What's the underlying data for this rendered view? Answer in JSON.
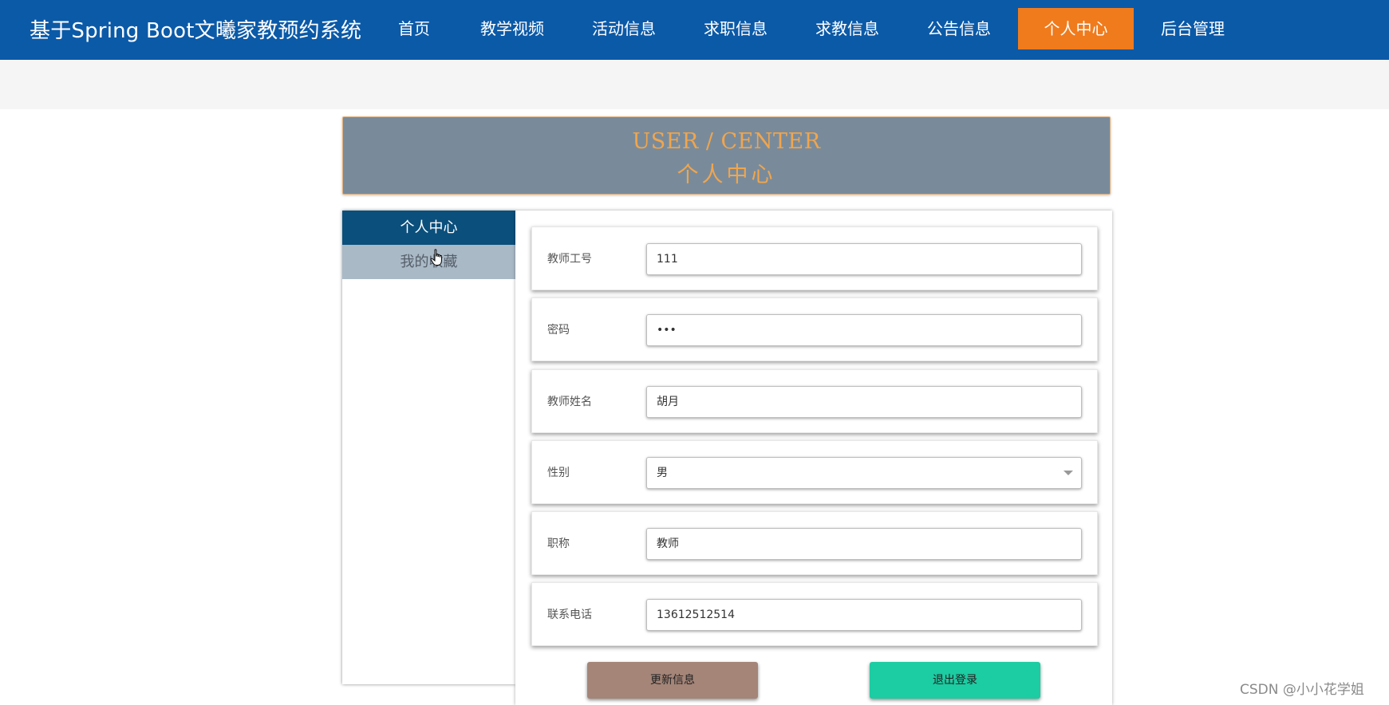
{
  "app": {
    "title": "基于Spring Boot文曦家教预约系统"
  },
  "nav": {
    "items": [
      {
        "label": "首页"
      },
      {
        "label": "教学视频"
      },
      {
        "label": "活动信息"
      },
      {
        "label": "求职信息"
      },
      {
        "label": "求教信息"
      },
      {
        "label": "公告信息"
      },
      {
        "label": "个人中心",
        "active": true
      },
      {
        "label": "后台管理"
      }
    ],
    "active_color": "#f07b1c",
    "bar_color": "#0b5aa8"
  },
  "header": {
    "title_en": "USER / CENTER",
    "title_cn": "个人中心"
  },
  "sidebar": {
    "items": [
      {
        "label": "个人中心",
        "active": true
      },
      {
        "label": "我的收藏"
      }
    ]
  },
  "form": {
    "fields": [
      {
        "label": "教师工号",
        "value": "111"
      },
      {
        "label": "密码",
        "value": "•••"
      },
      {
        "label": "教师姓名",
        "value": "胡月"
      },
      {
        "label": "性别",
        "value": "男",
        "type": "select"
      },
      {
        "label": "职称",
        "value": "教师"
      },
      {
        "label": "联系电话",
        "value": "13612512514"
      }
    ],
    "update_label": "更新信息",
    "logout_label": "退出登录"
  },
  "watermark": "CSDN @小小花学姐",
  "icons": {
    "cursor": "hand-pointer-icon",
    "dropdown": "chevron-down-icon"
  }
}
